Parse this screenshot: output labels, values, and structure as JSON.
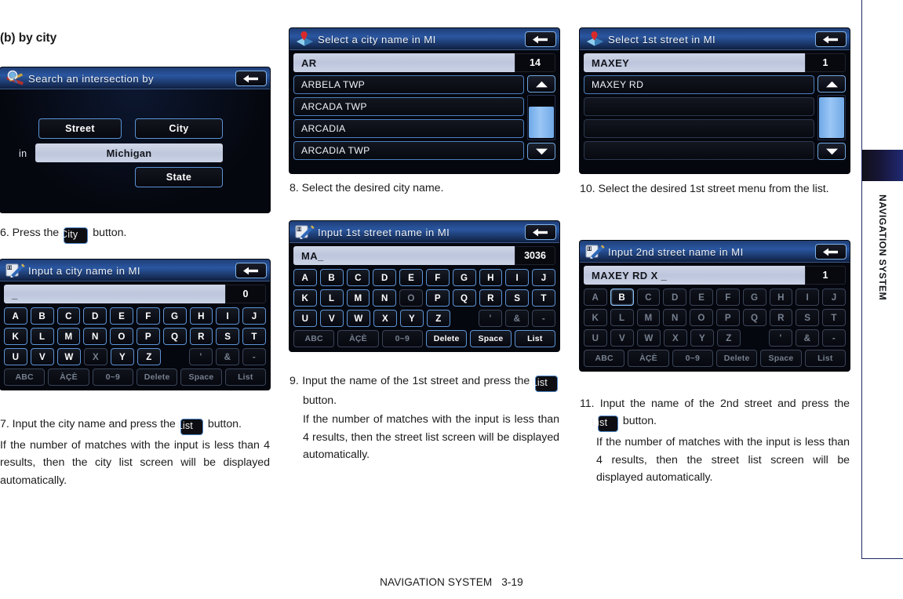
{
  "page": {
    "section_heading": "(b) by city",
    "footer_label": "NAVIGATION SYSTEM",
    "footer_page": "3-19",
    "rail_label": "NAVIGATION SYSTEM"
  },
  "screens": {
    "search_intersection": {
      "title": "Search an intersection by",
      "icon": "magnifier-intersection-icon",
      "back_icon": "back-arrow-icon",
      "street_button": "Street",
      "city_button": "City",
      "in_label": "in",
      "state_value": "Michigan",
      "state_button": "State"
    },
    "input_city": {
      "title": "Input a city name in MI",
      "icon": "notepad-pencil-icon",
      "back_icon": "back-arrow-icon",
      "entry_value": "_",
      "entry_count": "0",
      "rows": [
        [
          "A",
          "B",
          "C",
          "D",
          "E",
          "F",
          "G",
          "H",
          "I",
          "J"
        ],
        [
          "K",
          "L",
          "M",
          "N",
          "O",
          "P",
          "Q",
          "R",
          "S",
          "T"
        ],
        [
          "U",
          "V",
          "W",
          "X",
          "Y",
          "Z",
          "",
          "'",
          "&",
          "-"
        ]
      ],
      "disabled": [
        "X",
        "'",
        "&",
        "-"
      ],
      "function_keys": [
        "ABC",
        "ÀÇÈ",
        "0~9",
        "Delete",
        "Space",
        "List"
      ],
      "function_disabled": [
        "ABC",
        "ÀÇÈ",
        "0~9",
        "Delete",
        "Space",
        "List"
      ],
      "selected": []
    },
    "select_city": {
      "title": "Select a city name in MI",
      "icon": "map-pin-icon",
      "back_icon": "back-arrow-icon",
      "entry_value": "AR",
      "entry_count": "14",
      "items": [
        "ARBELA TWP",
        "ARCADA TWP",
        "ARCADIA",
        "ARCADIA TWP"
      ],
      "scroll_up_icon": "triangle-up-icon",
      "scroll_down_icon": "triangle-down-icon"
    },
    "input_street1": {
      "title": "Input 1st street name in MI",
      "icon": "notepad-pencil-icon",
      "back_icon": "back-arrow-icon",
      "entry_value": "MA_",
      "entry_count": "3036",
      "rows": [
        [
          "A",
          "B",
          "C",
          "D",
          "E",
          "F",
          "G",
          "H",
          "I",
          "J"
        ],
        [
          "K",
          "L",
          "M",
          "N",
          "O",
          "P",
          "Q",
          "R",
          "S",
          "T"
        ],
        [
          "U",
          "V",
          "W",
          "X",
          "Y",
          "Z",
          "",
          "'",
          "&",
          "-"
        ]
      ],
      "disabled": [
        "O",
        "'",
        "&",
        "-"
      ],
      "function_keys": [
        "ABC",
        "ÀÇÈ",
        "0~9",
        "Delete",
        "Space",
        "List"
      ],
      "function_disabled": [
        "ABC",
        "ÀÇÈ",
        "0~9"
      ],
      "selected": []
    },
    "select_street1": {
      "title": "Select 1st street in MI",
      "icon": "map-pin-icon",
      "back_icon": "back-arrow-icon",
      "entry_value": "MAXEY",
      "entry_count": "1",
      "items": [
        "MAXEY RD",
        "",
        "",
        ""
      ],
      "scroll_up_icon": "triangle-up-icon",
      "scroll_down_icon": "triangle-down-icon"
    },
    "input_street2": {
      "title": "Input 2nd street name in MI",
      "icon": "notepad-pencil-icon",
      "back_icon": "back-arrow-icon",
      "entry_value": "MAXEY RD X _",
      "entry_count": "1",
      "rows": [
        [
          "A",
          "B",
          "C",
          "D",
          "E",
          "F",
          "G",
          "H",
          "I",
          "J"
        ],
        [
          "K",
          "L",
          "M",
          "N",
          "O",
          "P",
          "Q",
          "R",
          "S",
          "T"
        ],
        [
          "U",
          "V",
          "W",
          "X",
          "Y",
          "Z",
          "",
          "'",
          "&",
          "-"
        ]
      ],
      "disabled": [
        "A",
        "C",
        "D",
        "E",
        "F",
        "G",
        "H",
        "I",
        "J",
        "K",
        "L",
        "M",
        "N",
        "O",
        "P",
        "Q",
        "R",
        "S",
        "T",
        "U",
        "V",
        "W",
        "X",
        "Y",
        "Z",
        "'",
        "&",
        "-"
      ],
      "function_keys": [
        "ABC",
        "ÀÇÈ",
        "0~9",
        "Delete",
        "Space",
        "List"
      ],
      "function_disabled": [
        "ABC",
        "ÀÇÈ",
        "0~9",
        "Delete",
        "Space",
        "List"
      ],
      "selected": [
        "B"
      ]
    }
  },
  "steps": {
    "s6": {
      "num": "6.",
      "pre": "Press the",
      "button": "City",
      "post": "button."
    },
    "s7": {
      "num": "7.",
      "pre": "Input the city name and press the",
      "button": "List",
      "post": "button.",
      "note": "If the number of matches with the input is less than 4 results, then the city list screen will be displayed automatically."
    },
    "s8": {
      "num": "8.",
      "text": "Select the desired city name."
    },
    "s9": {
      "num": "9.",
      "pre": "Input the name of the 1st street and press the",
      "button": "List",
      "post": "button.",
      "note": "If the number of matches with the input is less than 4 results, then the street list screen will be displayed automatically."
    },
    "s10": {
      "num": "10.",
      "text": "Select the desired 1st street menu from the list."
    },
    "s11": {
      "num": "11.",
      "pre": "Input the name of the 2nd street and press the",
      "button": "List",
      "post": "button.",
      "note": "If the number of matches with the input is less than 4 results, then the street list screen will be displayed automatically."
    }
  },
  "colors": {
    "accent_blue": "#5b93d6",
    "title_blue": "#2a56a0",
    "rail_navy": "#1d2a66",
    "screen_black": "#05070e"
  }
}
